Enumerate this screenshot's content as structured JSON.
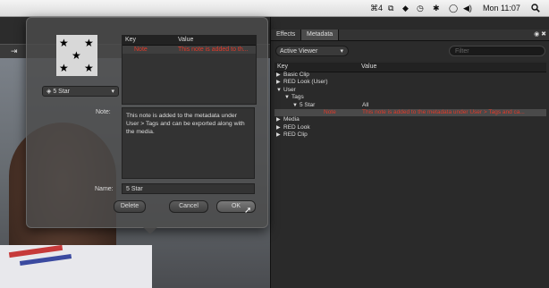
{
  "menubar": {
    "items": [
      "⌘4",
      "⧉",
      "◆",
      "◷",
      "✱",
      "◯",
      "◀)"
    ],
    "clock": "Mon 11:07",
    "search_icon": "search-icon"
  },
  "video": {
    "tool_glyph": "⇥"
  },
  "panel": {
    "tabs": [
      "Effects",
      "Metadata"
    ],
    "active_tab": "Metadata",
    "icons": "◉ ✖",
    "viewer_select": "Active Viewer",
    "filter_placeholder": "Filter",
    "columns": {
      "key": "Key",
      "value": "Value"
    },
    "tree": [
      {
        "arrow": "▶",
        "label": "Basic Clip",
        "value": "",
        "indent": 0,
        "red": false,
        "selected": false
      },
      {
        "arrow": "▶",
        "label": "RED Look (User)",
        "value": "",
        "indent": 0,
        "red": false,
        "selected": false
      },
      {
        "arrow": "▼",
        "label": "User",
        "value": "",
        "indent": 0,
        "red": false,
        "selected": false
      },
      {
        "arrow": "▼",
        "label": "Tags",
        "value": "",
        "indent": 1,
        "red": false,
        "selected": false
      },
      {
        "arrow": "▼",
        "label": "5 Star",
        "value": "All",
        "indent": 2,
        "red": false,
        "selected": false
      },
      {
        "arrow": "",
        "label": "Note",
        "value": "This note is added to the metadata under User > Tags and ca...",
        "indent": 3,
        "red": true,
        "selected": true
      },
      {
        "arrow": "▶",
        "label": "Media",
        "value": "",
        "indent": 0,
        "red": false,
        "selected": false
      },
      {
        "arrow": "▶",
        "label": "RED Look",
        "value": "",
        "indent": 0,
        "red": false,
        "selected": false
      },
      {
        "arrow": "▶",
        "label": "RED Clip",
        "value": "",
        "indent": 0,
        "red": false,
        "selected": false
      }
    ]
  },
  "dialog": {
    "title": "",
    "toolbar": "",
    "thumbnail_stars": [
      "★",
      "★",
      "★",
      "★",
      "★"
    ],
    "star_select": "5 Star",
    "kv_columns": {
      "key": "Key",
      "value": "Value"
    },
    "kv_row": {
      "key": "Note",
      "value": "This note is added to th..."
    },
    "note_label": "Note:",
    "note_text": "This note is added to the metadata under User > Tags and can be exported along with the media.",
    "name_label": "Name:",
    "name_value": "5 Star",
    "buttons": {
      "delete": "Delete",
      "cancel": "Cancel",
      "ok": "OK"
    }
  },
  "colors": {
    "accent_red": "#e33a2a",
    "panel_bg": "#2a2a2a"
  }
}
